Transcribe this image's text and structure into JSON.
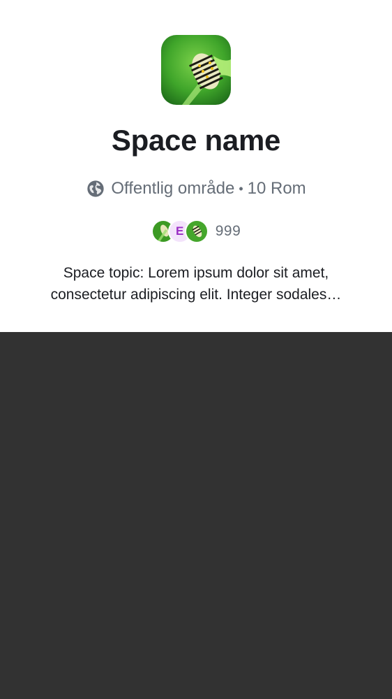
{
  "space": {
    "name": "Space name",
    "visibility": "Offentlig område",
    "separator": "•",
    "rooms": "10 Rom",
    "member_count": "999",
    "member_initial": "E",
    "topic": "Space topic: Lorem ipsum dolor sit amet, consectetur adipiscing elit. Integer sodales…"
  },
  "colors": {
    "background": "#323232",
    "card": "#ffffff",
    "primary_text": "#1b1d22",
    "secondary_text": "#656d77",
    "initial_avatar_bg": "#f3e3fb",
    "initial_avatar_fg": "#9a2cc4"
  },
  "icons": {
    "visibility": "globe-icon"
  }
}
